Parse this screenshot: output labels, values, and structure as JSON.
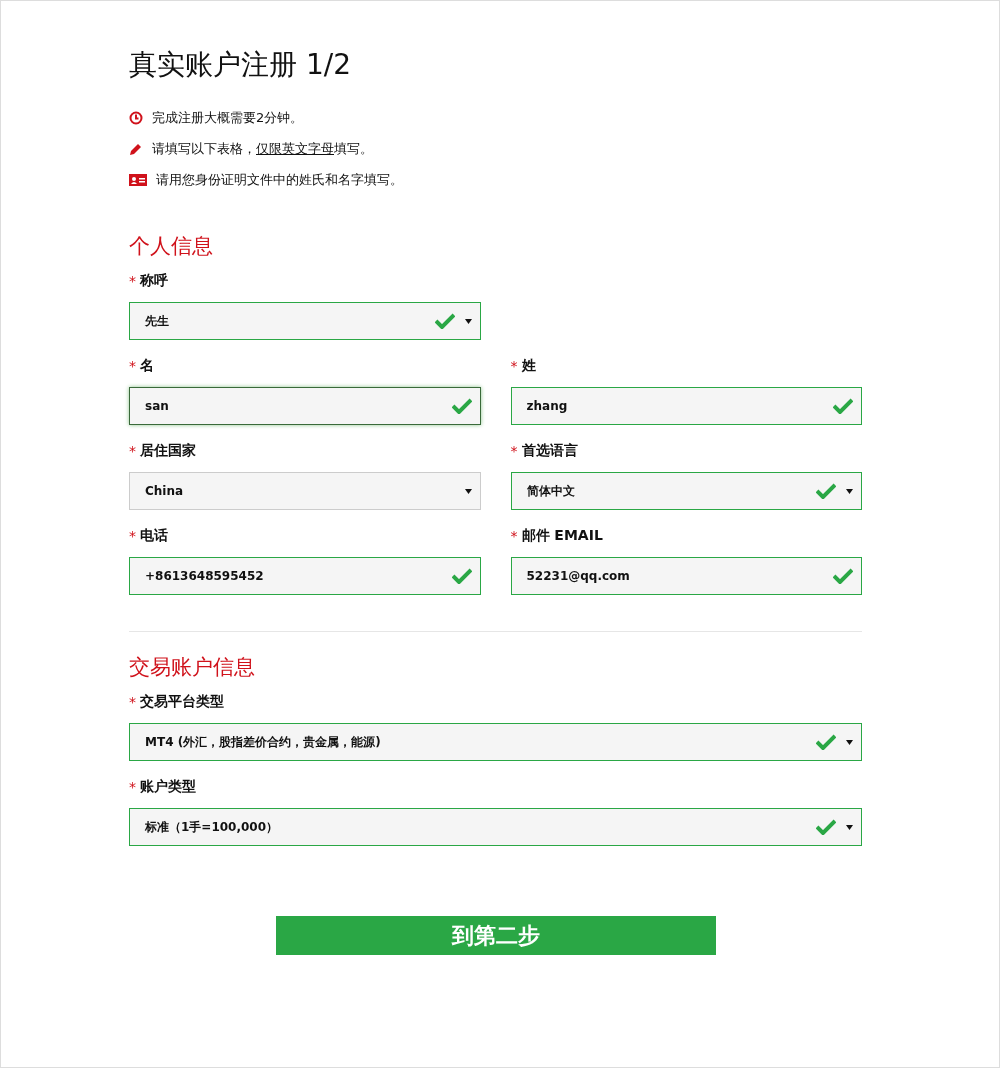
{
  "title": "真实账户注册 1/2",
  "notes": [
    {
      "text": "完成注册大概需要2分钟。"
    },
    {
      "text": "请填写以下表格，",
      "link": "仅限英文字母",
      "after": "填写。"
    },
    {
      "text": "请用您身份证明文件中的姓氏和名字填写。"
    }
  ],
  "sections": [
    {
      "title": "个人信息",
      "kind": "half",
      "rows": [
        [
          {
            "required": "*",
            "label": "称呼",
            "kind": "select",
            "value": "先生",
            "valid": true,
            "focused": false
          }
        ],
        [
          {
            "required": "*",
            "label": "名",
            "kind": "text",
            "value": "san",
            "valid": true,
            "focused": true
          },
          {
            "required": "*",
            "label": "姓",
            "kind": "text",
            "value": "zhang",
            "valid": true,
            "focused": false
          }
        ],
        [
          {
            "required": "*",
            "label": "居住国家",
            "kind": "select",
            "value": "China",
            "valid": false,
            "focused": false
          },
          {
            "required": "*",
            "label": "首选语言",
            "kind": "select",
            "value": "简体中文",
            "valid": true,
            "focused": false
          }
        ],
        [
          {
            "required": "*",
            "label": "电话",
            "kind": "text",
            "value": "+8613648595452",
            "valid": true,
            "focused": false
          },
          {
            "required": "*",
            "label": "邮件 EMAIL",
            "kind": "text",
            "value": "52231@qq.com",
            "valid": true,
            "focused": false
          }
        ]
      ]
    },
    {
      "title": "交易账户信息",
      "kind": "full",
      "rows": [
        [
          {
            "required": "*",
            "label": "交易平台类型",
            "kind": "select",
            "value": "MT4 (外汇，股指差价合约，贵金属，能源)",
            "valid": true,
            "focused": false
          }
        ],
        [
          {
            "required": "*",
            "label": "账户类型",
            "kind": "select",
            "value": "标准（1手=100,000）",
            "valid": true,
            "focused": false
          }
        ]
      ]
    }
  ],
  "submit": "到第二步"
}
